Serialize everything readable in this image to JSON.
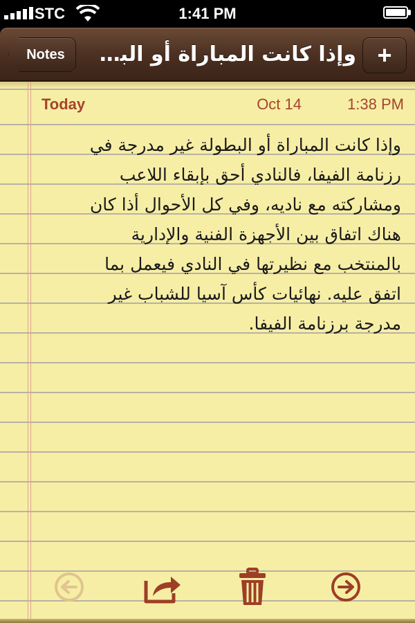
{
  "status_bar": {
    "carrier": "STC",
    "time": "1:41 PM"
  },
  "nav": {
    "back_label": "Notes",
    "title": "وإذا كانت المباراة أو البطولة غير مدرجة في رزنامة الفيفا",
    "add_label": "+"
  },
  "note": {
    "day": "Today",
    "date": "Oct 14",
    "time": "1:38 PM",
    "lines": [
      "وإذا كانت المباراة أو البطولة غير مدرجة في",
      "رزنامة الفيفا، فالنادي أحق بإبقاء اللاعب",
      "ومشاركته مع ناديه، وفي كل الأحوال أذا كان",
      "هناك اتفاق بين الأجهزة الفنية والإدارية",
      "بالمنتخب مع نظيرتها في النادي فيعمل بما",
      "اتفق عليه. نهائيات كأس آسيا للشباب غير",
      "مدرجة برزنامة الفيفا."
    ]
  },
  "toolbar": {
    "icons": [
      "previous-note-icon",
      "share-icon",
      "trash-icon",
      "next-note-icon"
    ],
    "previous_enabled": false
  },
  "colors": {
    "paper": "#f7eea6",
    "accent": "#a5442b",
    "nav": "#4d3122"
  }
}
